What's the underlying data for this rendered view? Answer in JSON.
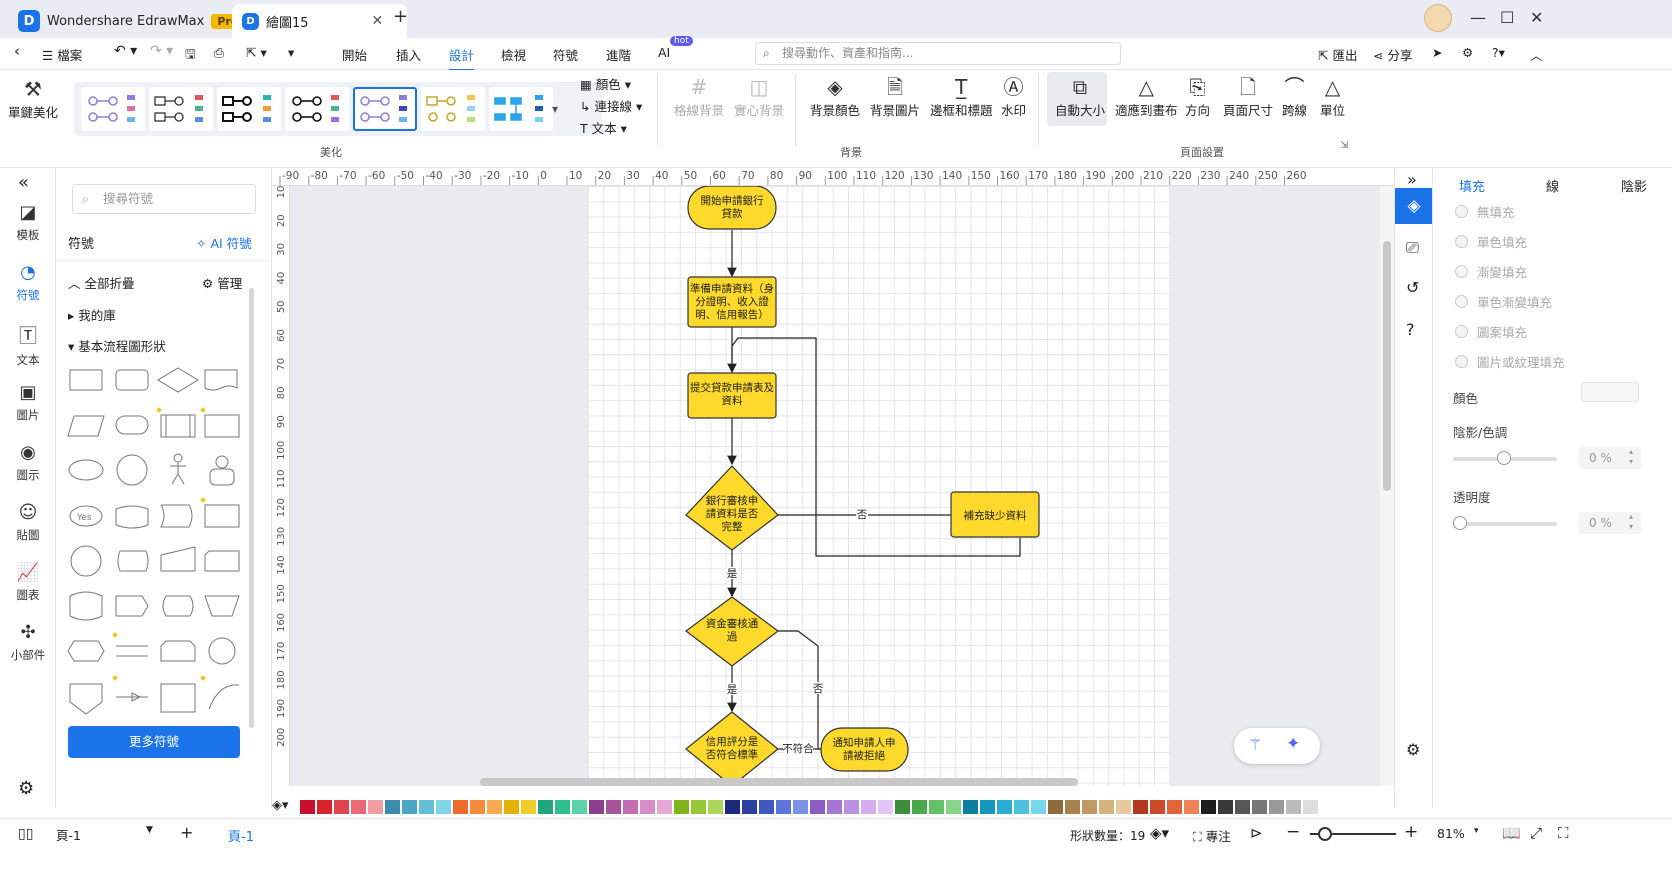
{
  "app": {
    "name": "Wondershare EdrawMax",
    "badge": "Pro",
    "doc_tab": "繪圖15"
  },
  "menubar": {
    "file": "檔案",
    "items": [
      "開始",
      "插入",
      "設計",
      "檢視",
      "符號",
      "進階",
      "AI"
    ],
    "selected": "設計",
    "ai_badge": "hot",
    "search_placeholder": "搜尋動作、資產和指南...",
    "export": "匯出",
    "share": "分享"
  },
  "ribbon": {
    "one_click": "單鍵美化",
    "beautify_label": "美化",
    "color": "顏色",
    "connector": "連接線",
    "text": "文本",
    "grid_bg": "格線背景",
    "solid_bg": "實心背景",
    "bg_color": "背景顏色",
    "bg_image": "背景圖片",
    "border_title": "邊框和標題",
    "watermark": "水印",
    "background_label": "背景",
    "auto_size": "自動大小",
    "fit_canvas": "適應到畫布",
    "orientation": "方向",
    "page_size": "頁面尺寸",
    "jump_line": "跨線",
    "unit": "單位",
    "page_setup_label": "頁面設置"
  },
  "leftnav": {
    "items": [
      {
        "label": "模板",
        "icon": "template-icon"
      },
      {
        "label": "符號",
        "icon": "symbol-icon"
      },
      {
        "label": "文本",
        "icon": "text-icon"
      },
      {
        "label": "圖片",
        "icon": "image-icon"
      },
      {
        "label": "圖示",
        "icon": "icon-icon"
      },
      {
        "label": "貼圖",
        "icon": "sticker-icon"
      },
      {
        "label": "圖表",
        "icon": "chart-icon"
      },
      {
        "label": "小部件",
        "icon": "widget-icon"
      }
    ]
  },
  "symbols": {
    "search_placeholder": "搜尋符號",
    "title": "符號",
    "ai_symbols": "AI 符號",
    "collapse_all": "全部折疊",
    "manage": "管理",
    "my_library": "我的庫",
    "basic_flowchart": "基本流程圖形狀",
    "more": "更多符號",
    "yes_label": "Yes"
  },
  "ruler": {
    "top": [
      "-90",
      "-80",
      "-70",
      "-60",
      "-50",
      "-40",
      "-30",
      "-20",
      "-10",
      "0",
      "10",
      "20",
      "30",
      "40",
      "50",
      "60",
      "70",
      "80",
      "90",
      "100",
      "110",
      "120",
      "130",
      "140",
      "150",
      "160",
      "170",
      "180",
      "190",
      "200",
      "210",
      "220",
      "230",
      "240",
      "250",
      "260"
    ],
    "left": [
      "10",
      "20",
      "30",
      "40",
      "50",
      "60",
      "70",
      "80",
      "90",
      "100",
      "110",
      "120",
      "130",
      "140",
      "150",
      "160",
      "170",
      "180",
      "190",
      "200"
    ]
  },
  "flowchart": {
    "start": [
      "開始申請銀行",
      "貸款"
    ],
    "prepare": [
      "準備申請資料（身",
      "分證明、收入證",
      "明、信用報告）"
    ],
    "submit": [
      "提交貸款申請表及",
      "資料"
    ],
    "review": [
      "銀行審核申",
      "請資料是否",
      "完整"
    ],
    "supplement": "補充缺少資料",
    "funds": [
      "資金審核通",
      "過"
    ],
    "credit": [
      "信用評分是",
      "否符合標準"
    ],
    "notify": [
      "通知申請人申",
      "請被拒絕"
    ],
    "yes": "是",
    "no": "否",
    "not_meet": "不符合"
  },
  "rpanel": {
    "tabs": [
      "填充",
      "線",
      "陰影"
    ],
    "options": [
      "無填充",
      "單色填充",
      "漸變填充",
      "單色漸變填充",
      "圖案填充",
      "圖片或紋理填充"
    ],
    "color": "顏色",
    "shade": "陰影/色調",
    "shade_value": "0 %",
    "transparency": "透明度",
    "transparency_value": "0 %"
  },
  "status": {
    "page_select": "頁-1",
    "page_tab": "頁-1",
    "shape_count": "形狀數量：19",
    "focus": "專注",
    "zoom": "81%"
  },
  "colors": {
    "accent": "#1a73e8",
    "shape_fill": "#fcd92b",
    "shape_stroke": "#333333"
  }
}
